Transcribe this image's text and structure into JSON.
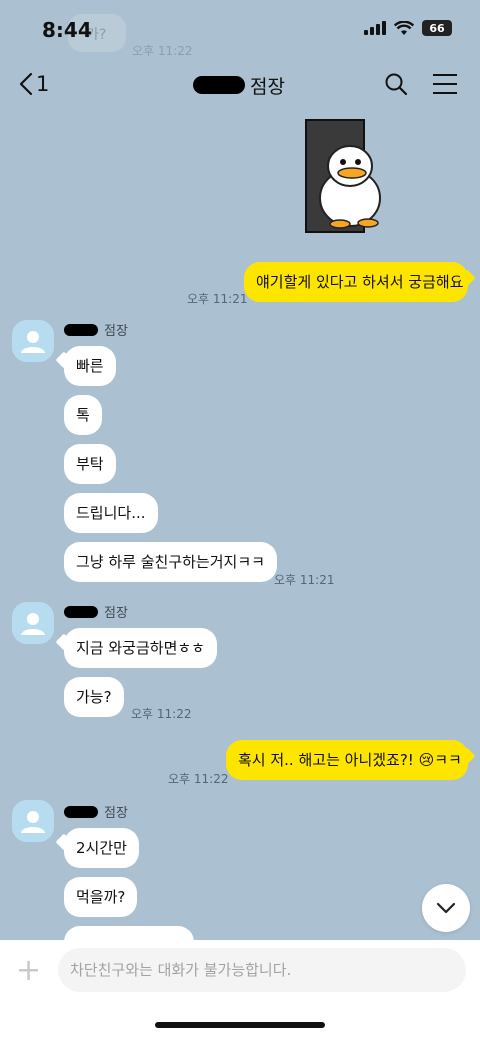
{
  "status_bar": {
    "time": "8:44",
    "battery": "66"
  },
  "ghost": {
    "text": "가?",
    "time": "오후 11:22"
  },
  "header": {
    "back_count": "1",
    "title": "점장"
  },
  "messages": {
    "me_1": {
      "text": "얘기할게 있다고 하셔서 궁금해요",
      "time": "오후 11:21"
    },
    "group_1": {
      "sender": "점장",
      "bubbles": [
        "빠른",
        "톡",
        "부탁",
        "드립니다...",
        "그냥 하루 술친구하는거지ㅋㅋ"
      ],
      "time": "오후 11:21"
    },
    "group_2": {
      "sender": "점장",
      "bubbles": [
        "지금 와궁금하면ㅎㅎ",
        "가능?"
      ],
      "time": "오후 11:22"
    },
    "me_2": {
      "text": "혹시 저.. 해고는 아니겠죠?! ",
      "emoji": "😢",
      "tail": "ㅋㅋ",
      "time": "오후 11:22"
    },
    "group_3": {
      "sender": "점장",
      "bubbles": [
        "2시간만",
        "먹을까?"
      ]
    }
  },
  "input": {
    "placeholder": "차단친구와는 대화가 불가능합니다."
  },
  "icons": {
    "back": "chevron-left-icon",
    "search": "search-icon",
    "menu": "menu-icon",
    "scroll": "chevron-down-icon",
    "add": "plus-icon"
  },
  "colors": {
    "background": "#abc1d1",
    "my_bubble": "#fee500",
    "their_bubble": "#ffffff"
  }
}
